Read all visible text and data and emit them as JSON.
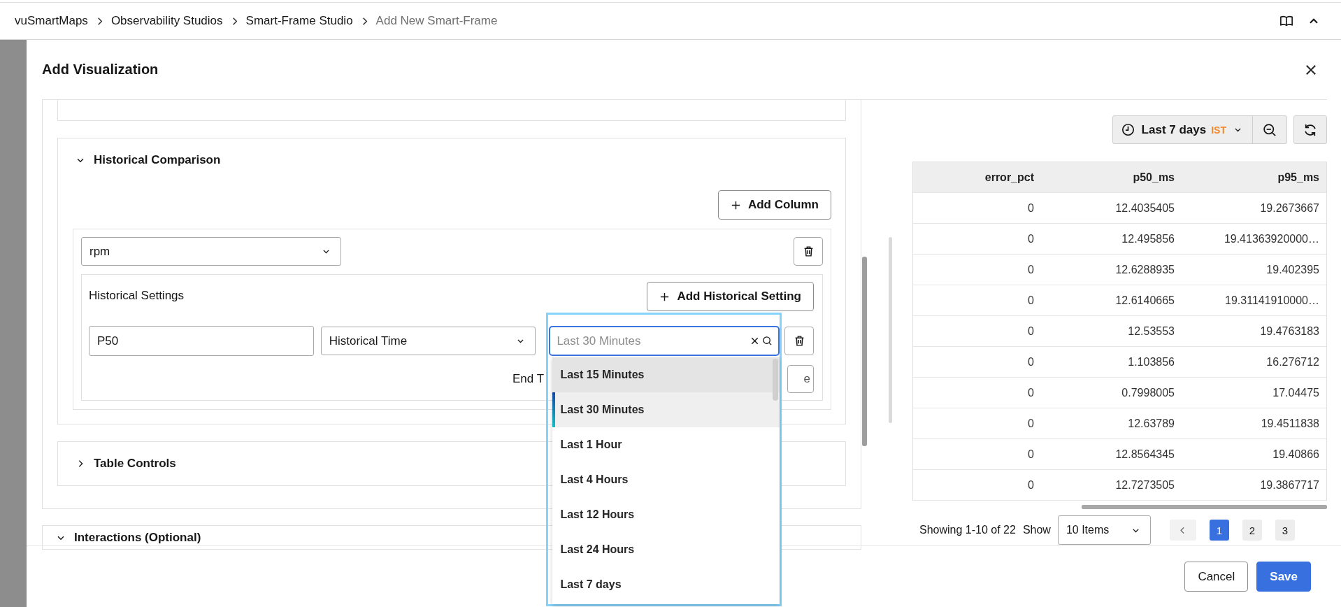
{
  "breadcrumb": [
    {
      "label": "vuSmartMaps",
      "current": false
    },
    {
      "label": "Observability Studios",
      "current": false
    },
    {
      "label": "Smart-Frame Studio",
      "current": false
    },
    {
      "label": "Add New Smart-Frame",
      "current": true
    }
  ],
  "dialog": {
    "title": "Add Visualization",
    "historical_comparison": {
      "title": "Historical Comparison",
      "expanded": true,
      "add_column_label": "Add Column",
      "columns": [
        {
          "metric": "rpm",
          "settings_title": "Historical Settings",
          "add_setting_label": "Add Historical Setting",
          "settings": [
            {
              "name": "P50",
              "type": "Historical Time",
              "time_search": {
                "placeholder": "Last 30 Minutes",
                "options": [
                  {
                    "label": "Last 15 Minutes",
                    "selected": false,
                    "highlighted": true
                  },
                  {
                    "label": "Last 30 Minutes",
                    "selected": true,
                    "highlighted": false
                  },
                  {
                    "label": "Last 1 Hour",
                    "selected": false,
                    "highlighted": false
                  },
                  {
                    "label": "Last 4 Hours",
                    "selected": false,
                    "highlighted": false
                  },
                  {
                    "label": "Last 12 Hours",
                    "selected": false,
                    "highlighted": false
                  },
                  {
                    "label": "Last 24 Hours",
                    "selected": false,
                    "highlighted": false
                  },
                  {
                    "label": "Last 7 days",
                    "selected": false,
                    "highlighted": false
                  }
                ]
              },
              "end_label": "End T",
              "end_button": "e"
            }
          ]
        }
      ]
    },
    "table_controls": {
      "title": "Table Controls",
      "expanded": false
    },
    "interactions": {
      "title": "Interactions (Optional)",
      "expanded": true
    },
    "preview": {
      "time_range": {
        "label": "Last 7 days",
        "timezone": "IST"
      },
      "table": {
        "columns": [
          "error_pct",
          "p50_ms",
          "p95_ms"
        ],
        "rows": [
          [
            "0",
            "12.4035405",
            "19.2673667"
          ],
          [
            "0",
            "12.495856",
            "19.41363920000…"
          ],
          [
            "0",
            "12.6288935",
            "19.402395"
          ],
          [
            "0",
            "12.6140665",
            "19.31141910000…"
          ],
          [
            "0",
            "12.53553",
            "19.4763183"
          ],
          [
            "0",
            "1.103856",
            "16.276712"
          ],
          [
            "0",
            "0.7998005",
            "17.04475"
          ],
          [
            "0",
            "12.63789",
            "19.4511838"
          ],
          [
            "0",
            "12.8564345",
            "19.40866"
          ],
          [
            "0",
            "12.7273505",
            "19.3867717"
          ]
        ]
      },
      "pagination": {
        "summary": "Showing 1-10 of 22",
        "show_label": "Show",
        "page_size": "10 Items",
        "pages": [
          {
            "label": "1",
            "selected": true
          },
          {
            "label": "2",
            "selected": false
          },
          {
            "label": "3",
            "selected": false
          }
        ]
      }
    },
    "buttons": [
      {
        "label": "Cancel",
        "kind": "secondary"
      },
      {
        "label": "Save",
        "kind": "primary"
      }
    ]
  }
}
